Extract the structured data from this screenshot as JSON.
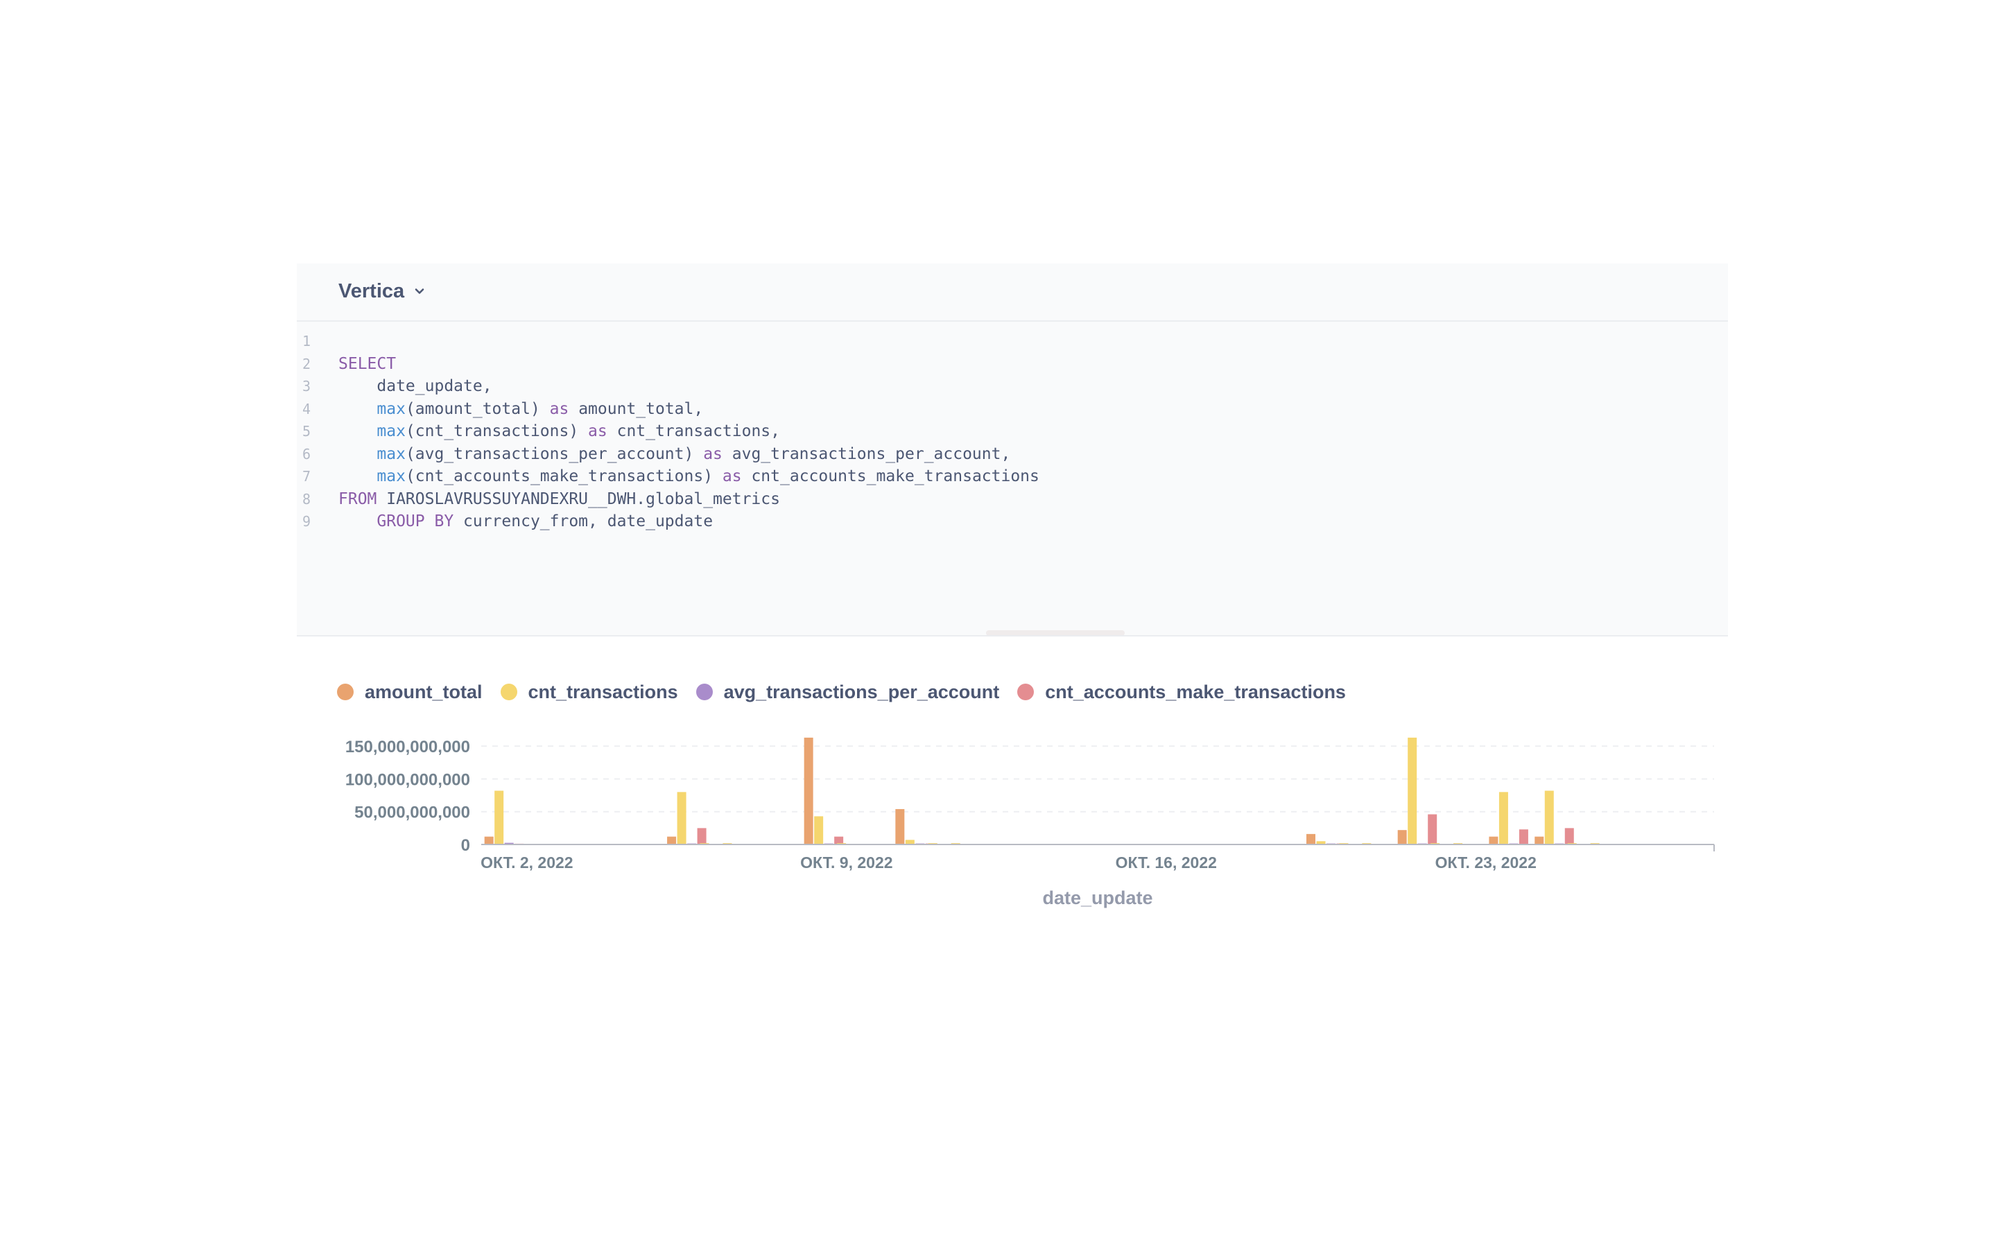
{
  "editor": {
    "database": "Vertica",
    "lines": [
      {
        "n": "1",
        "tokens": []
      },
      {
        "n": "2",
        "tokens": [
          {
            "t": "SELECT",
            "c": "kw"
          }
        ]
      },
      {
        "n": "3",
        "tokens": [
          {
            "t": "    date_update,",
            "c": ""
          }
        ]
      },
      {
        "n": "4",
        "tokens": [
          {
            "t": "    ",
            "c": ""
          },
          {
            "t": "max",
            "c": "fn"
          },
          {
            "t": "(amount_total) ",
            "c": ""
          },
          {
            "t": "as",
            "c": "kw"
          },
          {
            "t": " amount_total,",
            "c": ""
          }
        ]
      },
      {
        "n": "5",
        "tokens": [
          {
            "t": "    ",
            "c": ""
          },
          {
            "t": "max",
            "c": "fn"
          },
          {
            "t": "(cnt_transactions) ",
            "c": ""
          },
          {
            "t": "as",
            "c": "kw"
          },
          {
            "t": " cnt_transactions,",
            "c": ""
          }
        ]
      },
      {
        "n": "6",
        "tokens": [
          {
            "t": "    ",
            "c": ""
          },
          {
            "t": "max",
            "c": "fn"
          },
          {
            "t": "(avg_transactions_per_account) ",
            "c": ""
          },
          {
            "t": "as",
            "c": "kw"
          },
          {
            "t": " avg_transactions_per_account,",
            "c": ""
          }
        ]
      },
      {
        "n": "7",
        "tokens": [
          {
            "t": "    ",
            "c": ""
          },
          {
            "t": "max",
            "c": "fn"
          },
          {
            "t": "(cnt_accounts_make_transactions) ",
            "c": ""
          },
          {
            "t": "as",
            "c": "kw"
          },
          {
            "t": " cnt_accounts_make_transactions",
            "c": ""
          }
        ]
      },
      {
        "n": "8",
        "tokens": [
          {
            "t": "FROM",
            "c": "kw"
          },
          {
            "t": " IAROSLAVRUSSUYANDEXRU__DWH.global_metrics",
            "c": ""
          }
        ]
      },
      {
        "n": "9",
        "tokens": [
          {
            "t": "    ",
            "c": ""
          },
          {
            "t": "GROUP BY",
            "c": "kw"
          },
          {
            "t": " currency_from, date_update",
            "c": ""
          }
        ]
      }
    ]
  },
  "colors": {
    "amount_total": "#e9a36f",
    "cnt_transactions": "#f5d66e",
    "avg_transactions_per_account": "#a98ccb",
    "cnt_accounts_make_transactions": "#e48d91"
  },
  "chart_data": {
    "type": "bar",
    "xlabel": "date_update",
    "ylabel": "",
    "ylim": [
      0,
      165000000000
    ],
    "y_ticks": [
      {
        "value": 0,
        "label": "0"
      },
      {
        "value": 50000000000,
        "label": "50,000,000,000"
      },
      {
        "value": 100000000000,
        "label": "100,000,000,000"
      },
      {
        "value": 150000000000,
        "label": "150,000,000,000"
      }
    ],
    "x_range": [
      "2022-10-01",
      "2022-10-28"
    ],
    "x_ticks": [
      {
        "date": "2022-10-02",
        "label": "ОКТ. 2, 2022"
      },
      {
        "date": "2022-10-09",
        "label": "ОКТ. 9, 2022"
      },
      {
        "date": "2022-10-16",
        "label": "ОКТ. 16, 2022"
      },
      {
        "date": "2022-10-23",
        "label": "ОКТ. 23, 2022"
      }
    ],
    "grid": true,
    "legend": "top-left",
    "groups": [
      {
        "x": "2022-10-01 12:00",
        "values": [
          12000000000,
          82000000000,
          2500000000,
          1200000000
        ]
      },
      {
        "x": "2022-10-05 12:00",
        "values": [
          12000000000,
          80000000000,
          1500000000,
          25000000000
        ]
      },
      {
        "x": "2022-10-06 00:00",
        "values": [
          400000000,
          2000000000,
          1000000000,
          400000000
        ]
      },
      {
        "x": "2022-10-06 12:00",
        "values": [
          400000000,
          2000000000,
          1000000000,
          400000000
        ]
      },
      {
        "x": "2022-10-08 12:00",
        "values": [
          163000000000,
          43000000000,
          1500000000,
          12000000000
        ]
      },
      {
        "x": "2022-10-09 00:00",
        "values": [
          400000000,
          2000000000,
          1000000000,
          400000000
        ]
      },
      {
        "x": "2022-10-10 12:00",
        "values": [
          54000000000,
          7000000000,
          1500000000,
          1500000000
        ]
      },
      {
        "x": "2022-10-11 00:00",
        "values": [
          400000000,
          2000000000,
          1000000000,
          400000000
        ]
      },
      {
        "x": "2022-10-11 12:00",
        "values": [
          400000000,
          2000000000,
          1000000000,
          400000000
        ]
      },
      {
        "x": "2022-10-19 12:00",
        "values": [
          16000000000,
          5000000000,
          1500000000,
          1500000000
        ]
      },
      {
        "x": "2022-10-20 00:00",
        "values": [
          400000000,
          2000000000,
          1000000000,
          400000000
        ]
      },
      {
        "x": "2022-10-20 12:00",
        "values": [
          400000000,
          2000000000,
          1000000000,
          400000000
        ]
      },
      {
        "x": "2022-10-21 12:00",
        "values": [
          22000000000,
          163000000000,
          1500000000,
          46000000000
        ]
      },
      {
        "x": "2022-10-22 00:00",
        "values": [
          400000000,
          2000000000,
          1000000000,
          400000000
        ]
      },
      {
        "x": "2022-10-22 12:00",
        "values": [
          400000000,
          2000000000,
          1000000000,
          400000000
        ]
      },
      {
        "x": "2022-10-23 12:00",
        "values": [
          12000000000,
          80000000000,
          1500000000,
          23000000000
        ]
      },
      {
        "x": "2022-10-24 12:00",
        "values": [
          12000000000,
          82000000000,
          1500000000,
          25000000000
        ]
      },
      {
        "x": "2022-10-25 00:00",
        "values": [
          400000000,
          2000000000,
          1000000000,
          400000000
        ]
      },
      {
        "x": "2022-10-25 12:00",
        "values": [
          400000000,
          2000000000,
          1000000000,
          400000000
        ]
      }
    ],
    "series": [
      {
        "name": "amount_total"
      },
      {
        "name": "cnt_transactions"
      },
      {
        "name": "avg_transactions_per_account"
      },
      {
        "name": "cnt_accounts_make_transactions"
      }
    ]
  }
}
